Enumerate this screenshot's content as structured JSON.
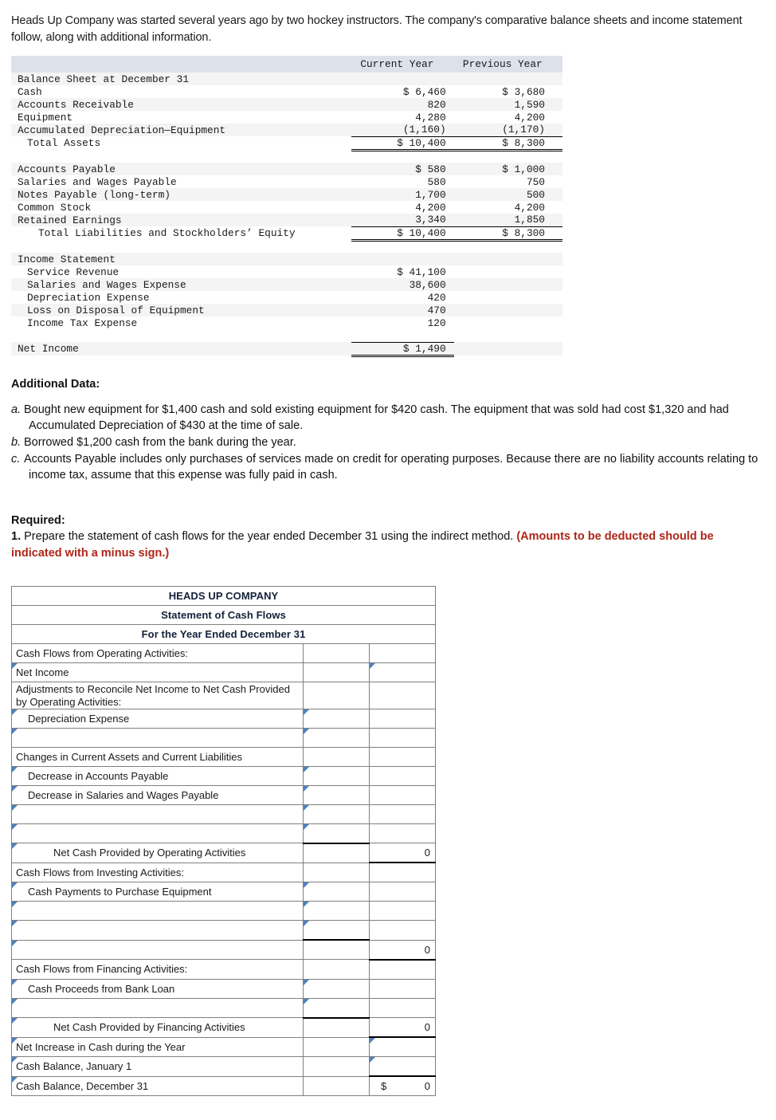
{
  "intro": "Heads Up Company was started several years ago by two hockey instructors. The company's comparative balance sheets and income statement follow, along with additional information.",
  "financials": {
    "col_headers": {
      "blank": "",
      "current": "Current Year",
      "previous": "Previous Year"
    },
    "rows": [
      {
        "label": "Balance Sheet at December 31",
        "current": "",
        "previous": "",
        "indent": 0
      },
      {
        "label": "Cash",
        "current": "$ 6,460",
        "previous": "$ 3,680",
        "indent": 0
      },
      {
        "label": "Accounts Receivable",
        "current": "820",
        "previous": "1,590",
        "indent": 0
      },
      {
        "label": "Equipment",
        "current": "4,280",
        "previous": "4,200",
        "indent": 0
      },
      {
        "label": "Accumulated Depreciation—Equipment",
        "current": "(1,160)",
        "previous": "(1,170)",
        "indent": 0
      },
      {
        "label": "Total Assets",
        "current": "$ 10,400",
        "previous": "$ 8,300",
        "indent": 1
      },
      {
        "label": "Accounts Payable",
        "current": "$ 580",
        "previous": "$ 1,000",
        "indent": 0
      },
      {
        "label": "Salaries and Wages Payable",
        "current": "580",
        "previous": "750",
        "indent": 0
      },
      {
        "label": "Notes Payable (long-term)",
        "current": "1,700",
        "previous": "500",
        "indent": 0
      },
      {
        "label": "Common Stock",
        "current": "4,200",
        "previous": "4,200",
        "indent": 0
      },
      {
        "label": "Retained Earnings",
        "current": "3,340",
        "previous": "1,850",
        "indent": 0
      },
      {
        "label": "Total Liabilities and Stockholders’ Equity",
        "current": "$ 10,400",
        "previous": "$ 8,300",
        "indent": 2
      },
      {
        "label": "Income Statement",
        "current": "",
        "previous": "",
        "indent": 0
      },
      {
        "label": "Service Revenue",
        "current": "$ 41,100",
        "previous": "",
        "indent": 1
      },
      {
        "label": "Salaries and Wages Expense",
        "current": "38,600",
        "previous": "",
        "indent": 1
      },
      {
        "label": "Depreciation Expense",
        "current": "420",
        "previous": "",
        "indent": 1
      },
      {
        "label": "Loss on Disposal of Equipment",
        "current": "470",
        "previous": "",
        "indent": 1
      },
      {
        "label": "Income Tax Expense",
        "current": "120",
        "previous": "",
        "indent": 1
      },
      {
        "label": "Net Income",
        "current": "$ 1,490",
        "previous": "",
        "indent": 0
      }
    ]
  },
  "additional": {
    "heading": "Additional Data:",
    "items": [
      {
        "marker": "a.",
        "text": "Bought new equipment for $1,400 cash and sold existing equipment for $420 cash. The equipment that was sold had cost $1,320 and had Accumulated Depreciation of $430 at the time of sale."
      },
      {
        "marker": "b.",
        "text": "Borrowed $1,200 cash from the bank during the year."
      },
      {
        "marker": "c.",
        "text": "Accounts Payable includes only purchases of services made on credit for operating purposes. Because there are no liability accounts relating to income tax, assume that this expense was fully paid in cash."
      }
    ]
  },
  "required": {
    "heading": "Required:",
    "number": "1.",
    "text": "Prepare the statement of cash flows for the year ended December 31 using the indirect method.",
    "red_note": "(Amounts to be deducted should be indicated with a minus sign.)"
  },
  "worksheet": {
    "title_line1": "HEADS UP COMPANY",
    "title_line2": "Statement of Cash Flows",
    "title_line3": "For the Year Ended December 31",
    "rows": [
      {
        "label": "Cash Flows from Operating Activities:",
        "indent": 0,
        "a": "",
        "b": "",
        "label_input": false,
        "a_input": false,
        "b_input": false
      },
      {
        "label": "Net Income",
        "indent": 0,
        "a": "",
        "b": "",
        "label_input": true,
        "a_input": false,
        "b_input": true
      },
      {
        "label": "Adjustments to Reconcile Net Income to Net Cash Provided by Operating Activities:",
        "indent": 0,
        "a": "",
        "b": "",
        "label_input": false,
        "a_input": false,
        "b_input": false,
        "two_line": true
      },
      {
        "label": "Depreciation Expense",
        "indent": 1,
        "a": "",
        "b": "",
        "label_input": true,
        "a_input": true,
        "b_input": false
      },
      {
        "label": "",
        "indent": 1,
        "a": "",
        "b": "",
        "label_input": true,
        "a_input": true,
        "b_input": false
      },
      {
        "label": "Changes in Current Assets and Current Liabilities",
        "indent": 0,
        "a": "",
        "b": "",
        "label_input": false,
        "a_input": false,
        "b_input": false
      },
      {
        "label": "Decrease in Accounts Payable",
        "indent": 1,
        "a": "",
        "b": "",
        "label_input": true,
        "a_input": true,
        "b_input": false
      },
      {
        "label": "Decrease in Salaries and Wages Payable",
        "indent": 1,
        "a": "",
        "b": "",
        "label_input": true,
        "a_input": true,
        "b_input": false
      },
      {
        "label": "",
        "indent": 1,
        "a": "",
        "b": "",
        "label_input": true,
        "a_input": true,
        "b_input": false
      },
      {
        "label": "",
        "indent": 1,
        "a": "",
        "b": "",
        "label_input": true,
        "a_input": true,
        "b_input": false,
        "a_rule_bottom": true
      },
      {
        "label": "Net Cash Provided by Operating Activities",
        "indent": 2,
        "a": "",
        "b": "0",
        "label_input": true,
        "a_input": false,
        "b_input": false,
        "b_rule_bottom": true
      },
      {
        "label": "Cash Flows from Investing Activities:",
        "indent": 0,
        "a": "",
        "b": "",
        "label_input": false,
        "a_input": false,
        "b_input": false
      },
      {
        "label": "Cash Payments to Purchase Equipment",
        "indent": 1,
        "a": "",
        "b": "",
        "label_input": true,
        "a_input": true,
        "b_input": false
      },
      {
        "label": "",
        "indent": 1,
        "a": "",
        "b": "",
        "label_input": true,
        "a_input": true,
        "b_input": false
      },
      {
        "label": "",
        "indent": 1,
        "a": "",
        "b": "",
        "label_input": true,
        "a_input": true,
        "b_input": false,
        "a_rule_bottom": true
      },
      {
        "label": "",
        "indent": 1,
        "a": "",
        "b": "0",
        "label_input": true,
        "a_input": false,
        "b_input": false,
        "b_rule_bottom": true
      },
      {
        "label": "Cash Flows from Financing Activities:",
        "indent": 0,
        "a": "",
        "b": "",
        "label_input": false,
        "a_input": false,
        "b_input": false
      },
      {
        "label": "Cash Proceeds from Bank Loan",
        "indent": 1,
        "a": "",
        "b": "",
        "label_input": true,
        "a_input": true,
        "b_input": false
      },
      {
        "label": "",
        "indent": 1,
        "a": "",
        "b": "",
        "label_input": true,
        "a_input": true,
        "b_input": false,
        "a_rule_bottom": true
      },
      {
        "label": "Net Cash Provided by Financing Activities",
        "indent": 2,
        "a": "",
        "b": "0",
        "label_input": true,
        "a_input": false,
        "b_input": false,
        "b_rule_bottom": true
      },
      {
        "label": "Net Increase in Cash during the Year",
        "indent": 0,
        "a": "",
        "b": "",
        "label_input": true,
        "a_input": false,
        "b_input": true
      },
      {
        "label": "Cash Balance, January 1",
        "indent": 0,
        "a": "",
        "b": "",
        "label_input": true,
        "a_input": false,
        "b_input": true
      },
      {
        "label": "Cash Balance, December 31",
        "indent": 0,
        "a": "",
        "b": "0",
        "b_prefix": "$",
        "label_input": true,
        "a_input": false,
        "b_input": false,
        "b_rule_top": true
      }
    ]
  }
}
